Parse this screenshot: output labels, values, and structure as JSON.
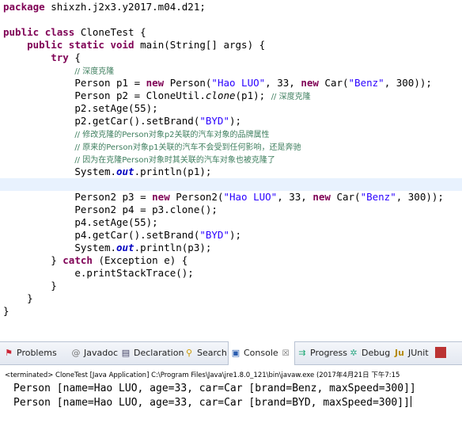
{
  "code": {
    "l1": {
      "kw": "package",
      "rest": " shixzh.j2x3.y2017.m04.d21;"
    },
    "l3": {
      "kw1": "public",
      "kw2": "class",
      "rest": " CloneTest {"
    },
    "l4": {
      "kw1": "public",
      "kw2": "static",
      "kw3": "void",
      "rest": " main(String[] args) {"
    },
    "l5": {
      "kw": "try",
      "rest": " {"
    },
    "l6": {
      "comment": "// 深度克隆"
    },
    "l7": {
      "a": "Person p1 = ",
      "new1": "new",
      "b": " Person(",
      "str1": "\"Hao LUO\"",
      "c": ", 33, ",
      "new2": "new",
      "d": " Car(",
      "str2": "\"Benz\"",
      "e": ", 300));"
    },
    "l8": {
      "a": "Person p2 = CloneUtil.",
      "method": "clone",
      "b": "(p1); ",
      "comment": "// 深度克隆"
    },
    "l9": {
      "text": "p2.setAge(55);"
    },
    "l10": {
      "a": "p2.getCar().setBrand(",
      "str": "\"BYD\"",
      "b": ");"
    },
    "l11": {
      "comment": "// 修改克隆的Person对象p2关联的汽车对象的品牌属性"
    },
    "l12": {
      "comment": "// 原来的Person对象p1关联的汽车不会受到任何影响，还是奔驰"
    },
    "l13": {
      "comment": "// 因为在克隆Person对象时其关联的汽车对象也被克隆了"
    },
    "l14": {
      "a": "System.",
      "field": "out",
      "b": ".println(p1);"
    },
    "l16": {
      "a": "Person2 p3 = ",
      "new1": "new",
      "b": " Person2(",
      "str1": "\"Hao LUO\"",
      "c": ", 33, ",
      "new2": "new",
      "d": " Car(",
      "str2": "\"Benz\"",
      "e": ", 300));"
    },
    "l17": {
      "text": "Person2 p4 = p3.clone();"
    },
    "l18": {
      "text": "p4.setAge(55);"
    },
    "l19": {
      "a": "p4.getCar().setBrand(",
      "str": "\"BYD\"",
      "b": ");"
    },
    "l20": {
      "a": "System.",
      "field": "out",
      "b": ".println(p3);"
    },
    "l21": {
      "a": "} ",
      "kw": "catch",
      "b": " (Exception e) {"
    },
    "l22": {
      "text": "e.printStackTrace();"
    },
    "l23": {
      "text": "}"
    },
    "l24": {
      "text": "}"
    },
    "l25": {
      "text": "}"
    }
  },
  "tabs": [
    {
      "label": "Problems",
      "icon": "problems-icon"
    },
    {
      "label": "Javadoc",
      "icon": "javadoc-icon"
    },
    {
      "label": "Declaration",
      "icon": "declaration-icon"
    },
    {
      "label": "Search",
      "icon": "search-icon"
    },
    {
      "label": "Console",
      "icon": "console-icon",
      "close": "☒"
    },
    {
      "label": "Progress",
      "icon": "progress-icon"
    },
    {
      "label": "Debug",
      "icon": "debug-icon"
    },
    {
      "label": "JUnit",
      "icon": "junit-icon"
    }
  ],
  "console": {
    "terminated": "<terminated> CloneTest [Java Application] C:\\Program Files\\Java\\jre1.8.0_121\\bin\\javaw.exe (2017年4月21日 下午7:15",
    "output": [
      "Person [name=Hao LUO, age=33, car=Car [brand=Benz, maxSpeed=300]]",
      "Person [name=Hao LUO, age=33, car=Car [brand=BYD, maxSpeed=300]]"
    ]
  }
}
